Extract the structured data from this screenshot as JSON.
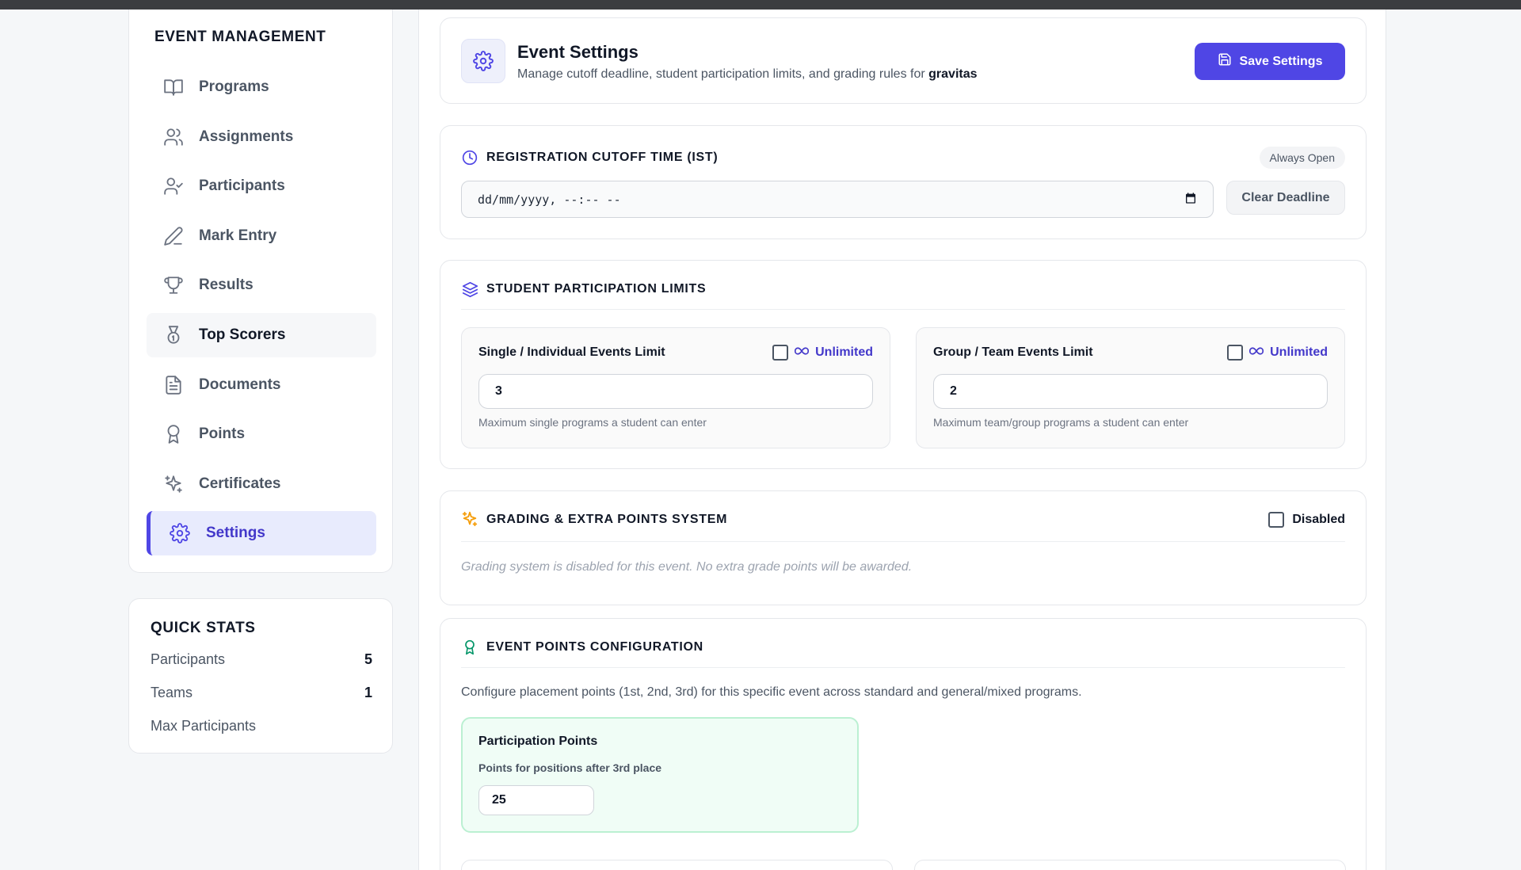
{
  "sidebar": {
    "title": "EVENT MANAGEMENT",
    "items": [
      {
        "label": "Programs",
        "icon": "book-open-icon"
      },
      {
        "label": "Assignments",
        "icon": "users-icon"
      },
      {
        "label": "Participants",
        "icon": "user-check-icon"
      },
      {
        "label": "Mark Entry",
        "icon": "pencil-icon"
      },
      {
        "label": "Results",
        "icon": "trophy-icon"
      },
      {
        "label": "Top Scorers",
        "icon": "medal-icon"
      },
      {
        "label": "Documents",
        "icon": "file-text-icon"
      },
      {
        "label": "Points",
        "icon": "award-icon"
      },
      {
        "label": "Certificates",
        "icon": "sparkles-icon"
      },
      {
        "label": "Settings",
        "icon": "gear-icon"
      }
    ],
    "active": "Settings",
    "hovered": "Top Scorers"
  },
  "quick_stats": {
    "title": "QUICK STATS",
    "rows": [
      {
        "label": "Participants",
        "value": "5"
      },
      {
        "label": "Teams",
        "value": "1"
      },
      {
        "label": "Max Participants",
        "value": ""
      }
    ]
  },
  "header": {
    "title": "Event Settings",
    "subtitle": "Manage cutoff deadline, student participation limits, and grading rules for",
    "event_name": "gravitas",
    "save_label": "Save Settings"
  },
  "cutoff": {
    "title": "REGISTRATION CUTOFF TIME (IST)",
    "badge": "Always Open",
    "placeholder": "dd/mm/yyyy, --:-- --",
    "clear_label": "Clear Deadline"
  },
  "limits": {
    "title": "STUDENT PARTICIPATION LIMITS",
    "single": {
      "label": "Single / Individual Events Limit",
      "unlimited_label": "Unlimited",
      "unlimited_checked": false,
      "value": "3",
      "help": "Maximum single programs a student can enter"
    },
    "group": {
      "label": "Group / Team Events Limit",
      "unlimited_label": "Unlimited",
      "unlimited_checked": false,
      "value": "2",
      "help": "Maximum team/group programs a student can enter"
    }
  },
  "grading": {
    "title": "GRADING & EXTRA POINTS SYSTEM",
    "toggle_label": "Disabled",
    "toggle_checked": false,
    "note": "Grading system is disabled for this event. No extra grade points will be awarded."
  },
  "points": {
    "title": "EVENT POINTS CONFIGURATION",
    "description": "Configure placement points (1st, 2nd, 3rd) for this specific event across standard and general/mixed programs.",
    "participation": {
      "title": "Participation Points",
      "subtitle": "Points for positions after 3rd place",
      "value": "25"
    }
  },
  "colors": {
    "accent": "#4f46e5",
    "active_bg": "#e8ebfd",
    "grading_icon": "#f59e0b",
    "points_icon": "#059669",
    "participation_bg": "#f0fdf6"
  }
}
